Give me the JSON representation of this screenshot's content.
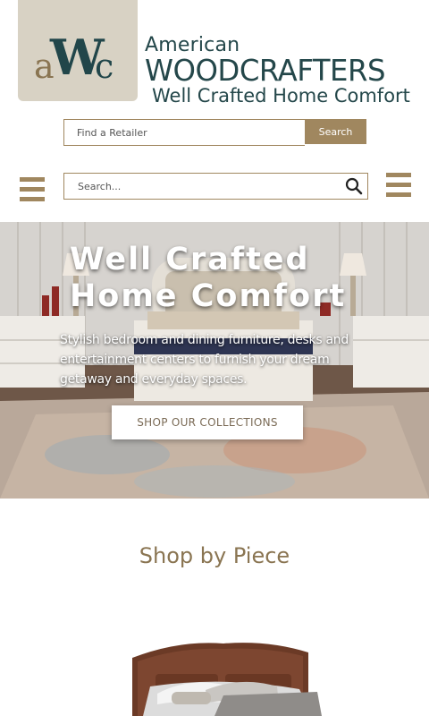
{
  "logo": {
    "monogram": {
      "a": "a",
      "w": "W",
      "c": "c"
    },
    "brand_top": "American",
    "brand_main": "WOODCRAFTERS",
    "tagline": "Well Crafted Home Comfort"
  },
  "retailer": {
    "placeholder": "Find a Retailer",
    "button_label": "Search"
  },
  "site_search": {
    "placeholder": "Search..."
  },
  "icons": {
    "menu_left": "hamburger-icon",
    "menu_right": "hamburger-icon",
    "search": "search-icon"
  },
  "hero": {
    "title_line1": "Well Crafted",
    "title_line2": "Home Comfort",
    "subtitle": "Stylish bedroom and dining furniture, desks and entertainment centers to furnish your dream getaway and everyday spaces.",
    "cta_label": "SHOP OUR COLLECTIONS"
  },
  "section": {
    "title": "Shop by Piece"
  },
  "colors": {
    "accent": "#a0875f",
    "brand_teal": "#24474a",
    "badge_bg": "#d8d2c4"
  }
}
